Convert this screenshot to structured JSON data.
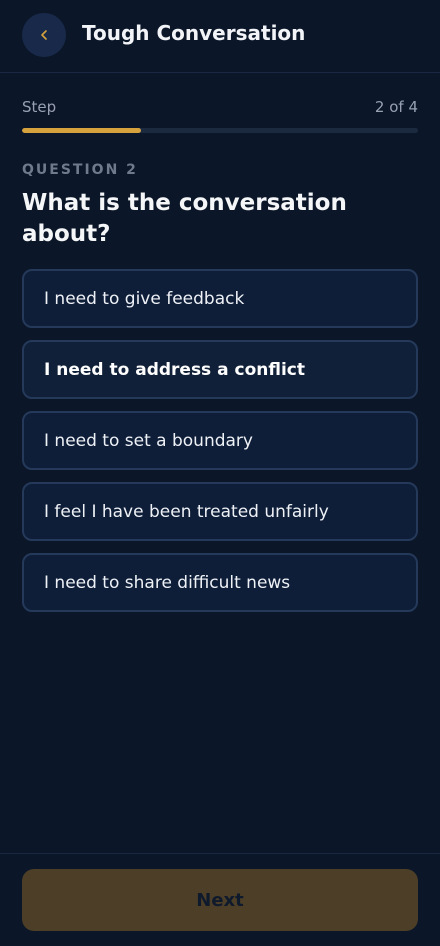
{
  "header": {
    "back_icon": "chevron-left-icon",
    "title": "Tough Conversation"
  },
  "step": {
    "label": "Step",
    "count": "2 of 4",
    "progress": 0.3
  },
  "question": {
    "eyebrow": "QUESTION 2",
    "title": "What is the conversation about?"
  },
  "options": [
    {
      "label": "I need to give feedback",
      "selected": false
    },
    {
      "label": "I need to address a conflict",
      "selected": true
    },
    {
      "label": "I need to set a boundary",
      "selected": false
    },
    {
      "label": "I feel I have been treated unfairly",
      "selected": false
    },
    {
      "label": "I need to share difficult news",
      "selected": false
    }
  ],
  "footer": {
    "next_label": "Next"
  },
  "colors": {
    "accent": "#d6a23e",
    "background": "#0b1628",
    "next_button_disabled": "#4d3f27"
  }
}
